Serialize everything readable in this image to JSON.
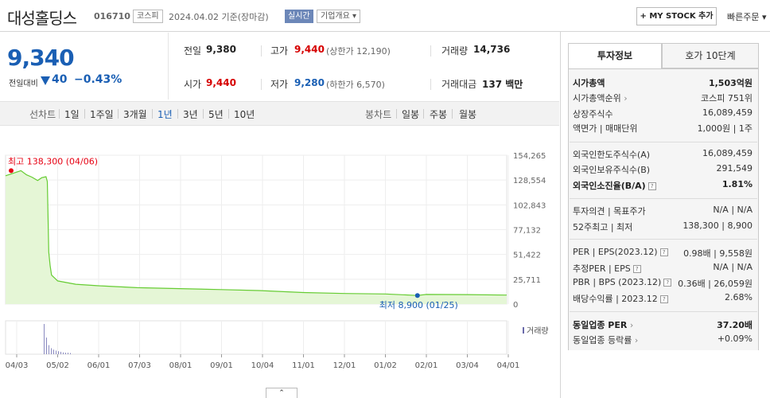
{
  "header": {
    "stock_name": "대성홀딩스",
    "stock_code": "016710",
    "market": "코스피",
    "date": "2024.04.02  기준(장마감)",
    "realtime": "실시간",
    "company_overview": "기업개요 ▾",
    "mystock_button": "+ MY STOCK 추가",
    "quick_order": "빠른주문 ▾"
  },
  "price": {
    "current": "9,340",
    "change_label": "전일대비",
    "change_value": "40",
    "change_rate": "−0.43%"
  },
  "stats": {
    "prev_close_label": "전일",
    "prev_close": "9,380",
    "high_label": "고가",
    "high": "9,440",
    "upper_limit": "(상한가 12,190)",
    "volume_label": "거래량",
    "volume": "14,736",
    "open_label": "시가",
    "open": "9,440",
    "low_label": "저가",
    "low": "9,280",
    "lower_limit": "(하한가 6,570)",
    "amount_label": "거래대금",
    "amount": "137 백만"
  },
  "period_tabs": {
    "line_label": "선차트",
    "line": [
      "1일",
      "1주일",
      "3개월",
      "1년",
      "3년",
      "5년",
      "10년"
    ],
    "candle_label": "봉차트",
    "candle": [
      "일봉",
      "주봉",
      "월봉"
    ]
  },
  "chart_data": {
    "type": "area",
    "x_ticks": [
      "04/03",
      "05/02",
      "06/01",
      "07/03",
      "08/01",
      "09/01",
      "10/04",
      "11/01",
      "12/01",
      "01/02",
      "02/01",
      "03/04",
      "04/01"
    ],
    "y_ticks": [
      "154,265",
      "128,554",
      "102,843",
      "77,132",
      "51,422",
      "25,711",
      "0"
    ],
    "ylim": [
      0,
      154265
    ],
    "series": [
      {
        "points": [
          [
            "04/03",
            133000
          ],
          [
            "04/06",
            138300
          ],
          [
            "04/10",
            134000
          ],
          [
            "04/14",
            131500
          ],
          [
            "04/18",
            128000
          ],
          [
            "04/21",
            131000
          ],
          [
            "04/24",
            132000
          ],
          [
            "04/25",
            127000
          ],
          [
            "04/26",
            54000
          ],
          [
            "04/27",
            40000
          ],
          [
            "04/28",
            30000
          ],
          [
            "05/02",
            24000
          ],
          [
            "05/15",
            20500
          ],
          [
            "06/01",
            19000
          ],
          [
            "07/01",
            17000
          ],
          [
            "08/01",
            16000
          ],
          [
            "09/01",
            15000
          ],
          [
            "10/01",
            14000
          ],
          [
            "11/01",
            12000
          ],
          [
            "12/01",
            11000
          ],
          [
            "01/02",
            10500
          ],
          [
            "01/25",
            8900
          ],
          [
            "02/01",
            10000
          ],
          [
            "03/04",
            9800
          ],
          [
            "04/02",
            9340
          ]
        ]
      }
    ],
    "max_annotation": "최고 138,300 (04/06)",
    "min_annotation": "최저 8,900 (01/25)",
    "volume_label": "거래량",
    "volume_bars": [
      1.0,
      0.55,
      0.3,
      0.2,
      0.15,
      0.12,
      0.1,
      0.08,
      0.06,
      0.05,
      0.05,
      0.04
    ],
    "colors": {
      "line": "#66cc33",
      "fill": "#e5f6d6",
      "max": "#e60012",
      "min": "#1a5fb4"
    },
    "grid": true
  },
  "right_panel": {
    "tabs": [
      "투자정보",
      "호가 10단계"
    ],
    "rows1": [
      {
        "label": "시가총액",
        "value": "1,503억원"
      },
      {
        "label": "시가총액순위",
        "value": "코스피 751위"
      },
      {
        "label": "상장주식수",
        "value": "16,089,459"
      },
      {
        "label": "액면가 | 매매단위",
        "value": "1,000원 | 1주"
      }
    ],
    "rows2": [
      {
        "label": "외국인한도주식수(A)",
        "value": "16,089,459"
      },
      {
        "label": "외국인보유주식수(B)",
        "value": "291,549"
      },
      {
        "label": "외국인소진율(B/A)",
        "value": "1.81%"
      }
    ],
    "rows3": [
      {
        "label": "투자의견 | 목표주가",
        "value": "N/A | N/A"
      },
      {
        "label": "52주최고 | 최저",
        "value": "138,300 | 8,900"
      }
    ],
    "rows4": [
      {
        "label": "PER | EPS(2023.12)",
        "value": "0.98배 | 9,558원"
      },
      {
        "label": "추정PER | EPS",
        "value": "N/A | N/A"
      },
      {
        "label": "PBR | BPS (2023.12)",
        "value": "0.36배 | 26,059원"
      },
      {
        "label": "배당수익률 | 2023.12",
        "value": "2.68%"
      }
    ],
    "rows5": [
      {
        "label": "동일업종 PER",
        "value": "37.20배"
      },
      {
        "label": "동일업종 등락률",
        "value": "+0.09%"
      }
    ]
  },
  "toggle_label": "⌃"
}
